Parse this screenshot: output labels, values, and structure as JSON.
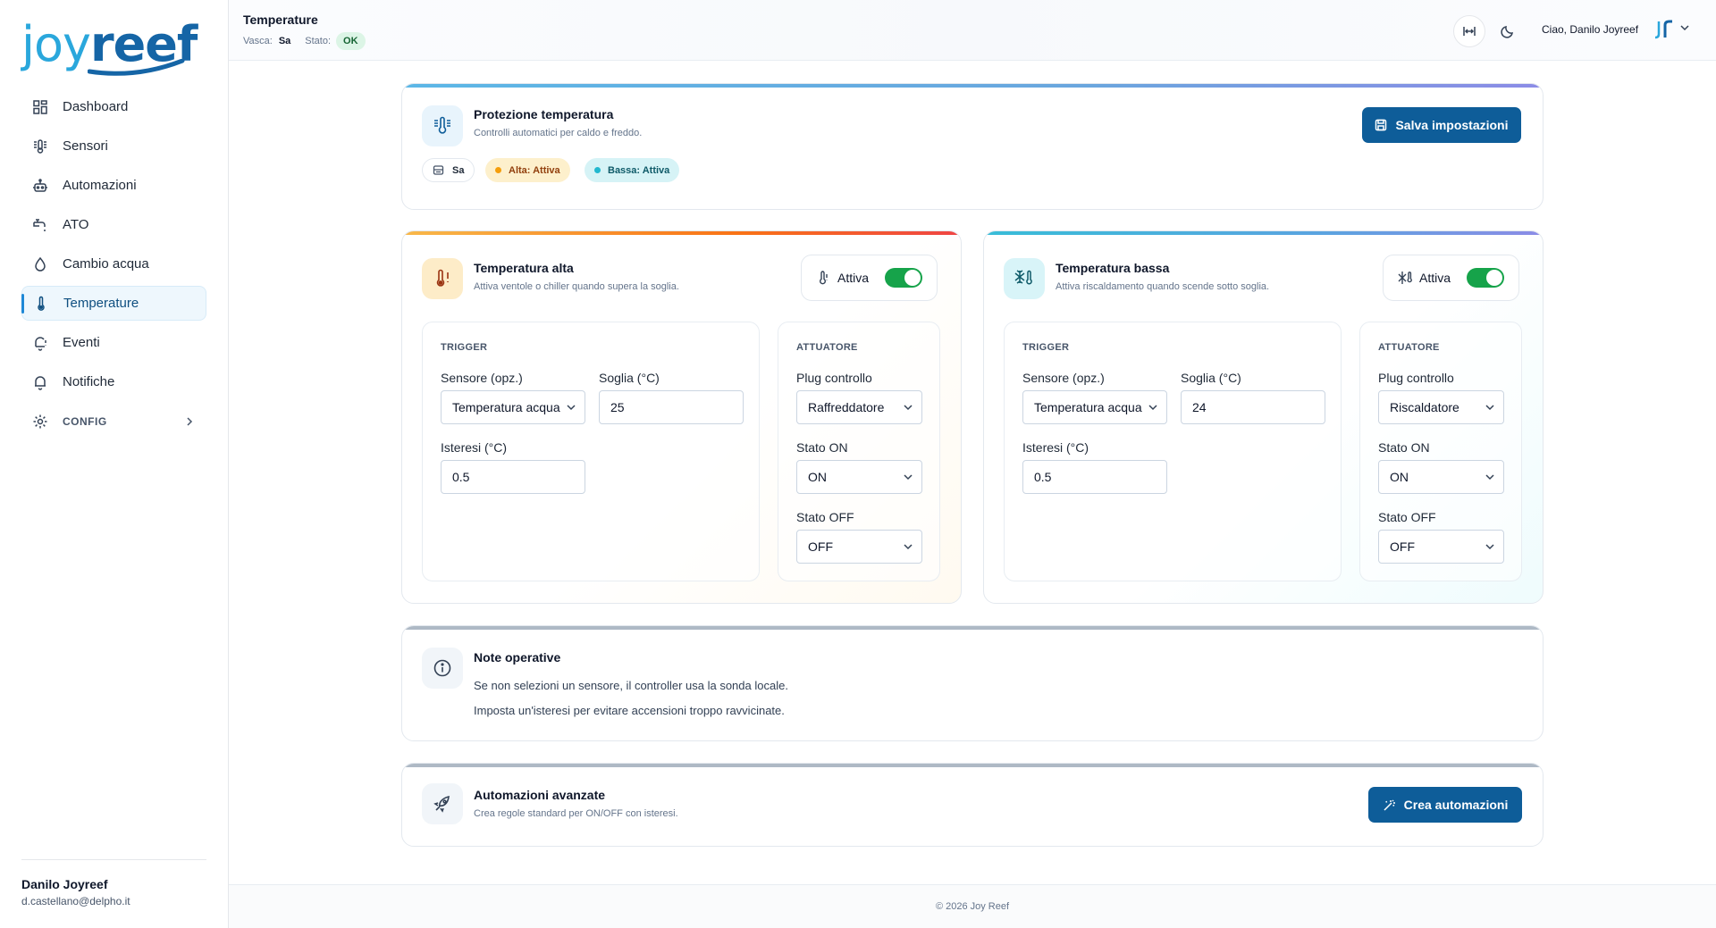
{
  "brand": {
    "part1": "joy",
    "part2": "reef"
  },
  "sidebar": {
    "items": [
      {
        "label": "Dashboard",
        "icon": "dashboard-icon"
      },
      {
        "label": "Sensori",
        "icon": "sensors-icon"
      },
      {
        "label": "Automazioni",
        "icon": "robot-icon"
      },
      {
        "label": "ATO",
        "icon": "faucet-icon"
      },
      {
        "label": "Cambio acqua",
        "icon": "water-drop-icon"
      },
      {
        "label": "Temperature",
        "icon": "thermometer-icon",
        "active": true
      },
      {
        "label": "Eventi",
        "icon": "bell-alert-icon"
      },
      {
        "label": "Notifiche",
        "icon": "bell-icon"
      },
      {
        "label": "CONFIG",
        "icon": "gear-icon",
        "expandable": true
      }
    ],
    "user": {
      "name": "Danilo Joyreef",
      "email": "d.castellano@delpho.it"
    }
  },
  "topbar": {
    "title": "Temperature",
    "tank_label": "Vasca:",
    "tank_value": "Sa",
    "status_label": "Stato:",
    "status_value": "OK",
    "greeting": "Ciao, Danilo Joyreef"
  },
  "protection": {
    "title": "Protezione temperatura",
    "subtitle": "Controlli automatici per caldo e freddo.",
    "save_label": "Salva impostazioni",
    "chips": {
      "tank": "Sa",
      "high": "Alta: Attiva",
      "low": "Bassa: Attiva"
    }
  },
  "high": {
    "title": "Temperatura alta",
    "subtitle": "Attiva ventole o chiller quando supera la soglia.",
    "toggle_label": "Attiva",
    "enabled": true,
    "trigger_title": "TRIGGER",
    "sensor_label": "Sensore (opz.)",
    "sensor_value": "Temperatura acqua",
    "threshold_label": "Soglia (°C)",
    "threshold_value": "25",
    "hysteresis_label": "Isteresi (°C)",
    "hysteresis_value": "0.5",
    "actuator_title": "ATTUATORE",
    "plug_label": "Plug controllo",
    "plug_value": "Raffreddatore",
    "on_label": "Stato ON",
    "on_value": "ON",
    "off_label": "Stato OFF",
    "off_value": "OFF"
  },
  "low": {
    "title": "Temperatura bassa",
    "subtitle": "Attiva riscaldamento quando scende sotto soglia.",
    "toggle_label": "Attiva",
    "enabled": true,
    "trigger_title": "TRIGGER",
    "sensor_label": "Sensore (opz.)",
    "sensor_value": "Temperatura acqua",
    "threshold_label": "Soglia (°C)",
    "threshold_value": "24",
    "hysteresis_label": "Isteresi (°C)",
    "hysteresis_value": "0.5",
    "actuator_title": "ATTUATORE",
    "plug_label": "Plug controllo",
    "plug_value": "Riscaldatore",
    "on_label": "Stato ON",
    "on_value": "ON",
    "off_label": "Stato OFF",
    "off_value": "OFF"
  },
  "notes": {
    "title": "Note operative",
    "line1": "Se non selezioni un sensore, il controller usa la sonda locale.",
    "line2": "Imposta un'isteresi per evitare accensioni troppo ravvicinate."
  },
  "advanced": {
    "title": "Automazioni avanzate",
    "subtitle": "Crea regole standard per ON/OFF con isteresi.",
    "button_label": "Crea automazioni"
  },
  "footer": {
    "text": "© 2026 Joy Reef"
  },
  "colors": {
    "primary": "#0e5d99",
    "active_bg": "#eef7fd",
    "ok_green": "#16a34a",
    "warm": "#f97316",
    "cool": "#22b8cf"
  }
}
